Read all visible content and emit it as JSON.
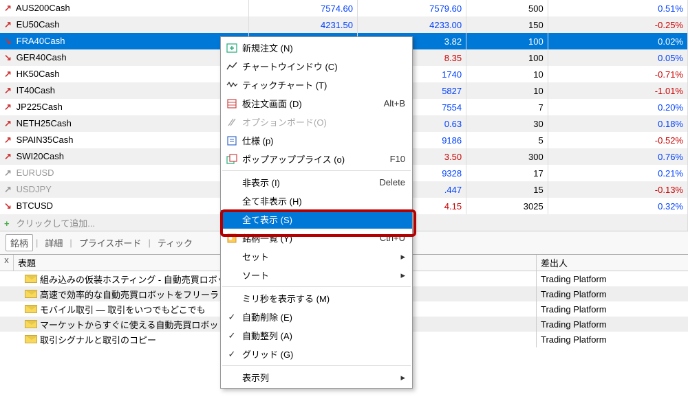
{
  "market": {
    "rows": [
      {
        "arrow": "↗",
        "dir": "up",
        "sym": "AUS200Cash",
        "bid": "7574.60",
        "bidCls": "val-blue",
        "ask": "7579.60",
        "askCls": "val-blue",
        "sz": "500",
        "pct": "0.51%",
        "pctCls": "val-blue",
        "sel": false
      },
      {
        "arrow": "↗",
        "dir": "up",
        "sym": "EU50Cash",
        "bid": "4231.50",
        "bidCls": "val-blue",
        "ask": "4233.00",
        "askCls": "val-blue",
        "sz": "150",
        "pct": "-0.25%",
        "pctCls": "val-red",
        "sel": false
      },
      {
        "arrow": "↘",
        "dir": "down",
        "sym": "FRA40Cash",
        "bid": "",
        "bidCls": "",
        "ask": "3.82",
        "askCls": "",
        "sz": "100",
        "pct": "0.02%",
        "pctCls": "",
        "sel": true
      },
      {
        "arrow": "↘",
        "dir": "down",
        "sym": "GER40Cash",
        "bid": "",
        "bidCls": "",
        "ask": "8.35",
        "askCls": "val-red",
        "sz": "100",
        "pct": "0.05%",
        "pctCls": "val-blue",
        "sel": false
      },
      {
        "arrow": "↗",
        "dir": "up",
        "sym": "HK50Cash",
        "bid": "",
        "bidCls": "",
        "ask": "1740",
        "askCls": "val-blue",
        "sz": "10",
        "pct": "-0.71%",
        "pctCls": "val-red",
        "sel": false
      },
      {
        "arrow": "↗",
        "dir": "up",
        "sym": "IT40Cash",
        "bid": "",
        "bidCls": "",
        "ask": "5827",
        "askCls": "val-blue",
        "sz": "10",
        "pct": "-1.01%",
        "pctCls": "val-red",
        "sel": false
      },
      {
        "arrow": "↗",
        "dir": "up",
        "sym": "JP225Cash",
        "bid": "",
        "bidCls": "",
        "ask": "7554",
        "askCls": "val-blue",
        "sz": "7",
        "pct": "0.20%",
        "pctCls": "val-blue",
        "sel": false
      },
      {
        "arrow": "↗",
        "dir": "up",
        "sym": "NETH25Cash",
        "bid": "",
        "bidCls": "",
        "ask": "0.63",
        "askCls": "val-blue",
        "sz": "30",
        "pct": "0.18%",
        "pctCls": "val-blue",
        "sel": false
      },
      {
        "arrow": "↗",
        "dir": "up",
        "sym": "SPAIN35Cash",
        "bid": "",
        "bidCls": "",
        "ask": "9186",
        "askCls": "val-blue",
        "sz": "5",
        "pct": "-0.52%",
        "pctCls": "val-red",
        "sel": false
      },
      {
        "arrow": "↗",
        "dir": "up",
        "sym": "SWI20Cash",
        "bid": "",
        "bidCls": "",
        "ask": "3.50",
        "askCls": "val-red",
        "sz": "300",
        "pct": "0.76%",
        "pctCls": "val-blue",
        "sel": false
      },
      {
        "arrow": "↗",
        "dir": "neutral",
        "sym": "EURUSD",
        "symCls": "val-gray",
        "bid": "",
        "bidCls": "",
        "ask": "9328",
        "askCls": "val-blue",
        "sz": "17",
        "pct": "0.21%",
        "pctCls": "val-blue",
        "sel": false
      },
      {
        "arrow": "↗",
        "dir": "neutral",
        "sym": "USDJPY",
        "symCls": "val-gray",
        "bid": "",
        "bidCls": "",
        "ask": ".447",
        "askCls": "val-blue",
        "sz": "15",
        "pct": "-0.13%",
        "pctCls": "val-red",
        "sel": false
      },
      {
        "arrow": "↘",
        "dir": "down",
        "sym": "BTCUSD",
        "bid": "",
        "bidCls": "",
        "ask": "4.15",
        "askCls": "val-red",
        "sz": "3025",
        "pct": "0.32%",
        "pctCls": "val-blue",
        "sel": false
      }
    ],
    "addLabel": "クリックして追加..."
  },
  "tabs": [
    "銘柄",
    "詳細",
    "プライスボード",
    "ティック"
  ],
  "ctx": {
    "items": [
      {
        "icon": "neworder",
        "label": "新規注文 (N)",
        "sc": ""
      },
      {
        "icon": "chart",
        "label": "チャートウインドウ (C)",
        "sc": ""
      },
      {
        "icon": "tick",
        "label": "ティックチャート (T)",
        "sc": ""
      },
      {
        "icon": "depth",
        "label": "板注文画面 (D)",
        "sc": "Alt+B"
      },
      {
        "icon": "option",
        "label": "オプションボード(O)",
        "sc": "",
        "disabled": true
      },
      {
        "icon": "spec",
        "label": "仕様 (p)",
        "sc": ""
      },
      {
        "icon": "popup",
        "label": "ポップアッププライス (o)",
        "sc": "F10"
      },
      {
        "sep": true
      },
      {
        "icon": "",
        "label": "非表示 (I)",
        "sc": "Delete"
      },
      {
        "icon": "",
        "label": "全て非表示 (H)",
        "sc": ""
      },
      {
        "icon": "",
        "label": "全て表示 (S)",
        "sc": "",
        "selected": true
      },
      {
        "icon": "list",
        "label": "銘柄一覧 (Y)",
        "sc": "Ctrl+U"
      },
      {
        "icon": "",
        "label": "セット",
        "sub": "▸"
      },
      {
        "icon": "",
        "label": "ソート",
        "sub": "▸"
      },
      {
        "sep": true
      },
      {
        "icon": "",
        "label": "ミリ秒を表示する (M)"
      },
      {
        "icon": "check",
        "label": "自動削除 (E)"
      },
      {
        "icon": "check",
        "label": "自動整列 (A)"
      },
      {
        "icon": "check",
        "label": "グリッド (G)"
      },
      {
        "sep": true
      },
      {
        "icon": "",
        "label": "表示列",
        "sub": "▸"
      }
    ]
  },
  "messages": {
    "hdrSubject": "表題",
    "hdrFrom": "差出人",
    "close": "x",
    "rows": [
      {
        "subj": "組み込みの仮装ホスティング - 自動売買ロボッ",
        "from": "Trading Platform"
      },
      {
        "subj": "高速で効率的な自動売買ロボットをフリーラン",
        "from": "Trading Platform"
      },
      {
        "subj": "モバイル取引 — 取引をいつでもどこでも",
        "from": "Trading Platform"
      },
      {
        "subj": "マーケットからすぐに使える自動売買ロボットと指",
        "from": "Trading Platform"
      },
      {
        "subj": "取引シグナルと取引のコピー",
        "from": "Trading Platform"
      }
    ]
  }
}
